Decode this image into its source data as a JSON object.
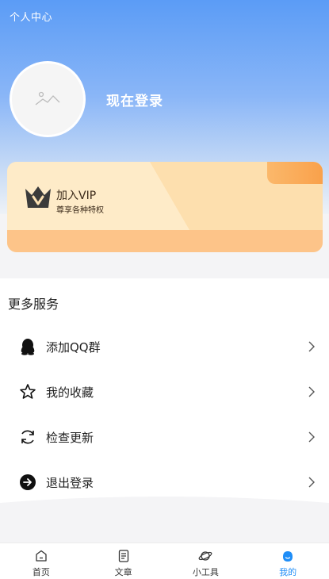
{
  "header": {
    "title": "个人中心",
    "login_text": "现在登录"
  },
  "vip": {
    "title": "加入VIP",
    "subtitle": "尊享各种特权"
  },
  "services": {
    "title": "更多服务",
    "items": [
      {
        "label": "添加QQ群",
        "icon": "qq-icon"
      },
      {
        "label": "我的收藏",
        "icon": "star-icon"
      },
      {
        "label": "检查更新",
        "icon": "refresh-icon"
      },
      {
        "label": "退出登录",
        "icon": "logout-icon"
      }
    ]
  },
  "tabbar": {
    "items": [
      {
        "label": "首页",
        "icon": "home-icon"
      },
      {
        "label": "文章",
        "icon": "article-icon"
      },
      {
        "label": "小工具",
        "icon": "planet-icon"
      },
      {
        "label": "我的",
        "icon": "profile-icon"
      }
    ],
    "active_index": 3
  },
  "colors": {
    "header_blue": "#5b9cf6",
    "vip_gold": "#fde2b4",
    "accent": "#1e8df7"
  }
}
